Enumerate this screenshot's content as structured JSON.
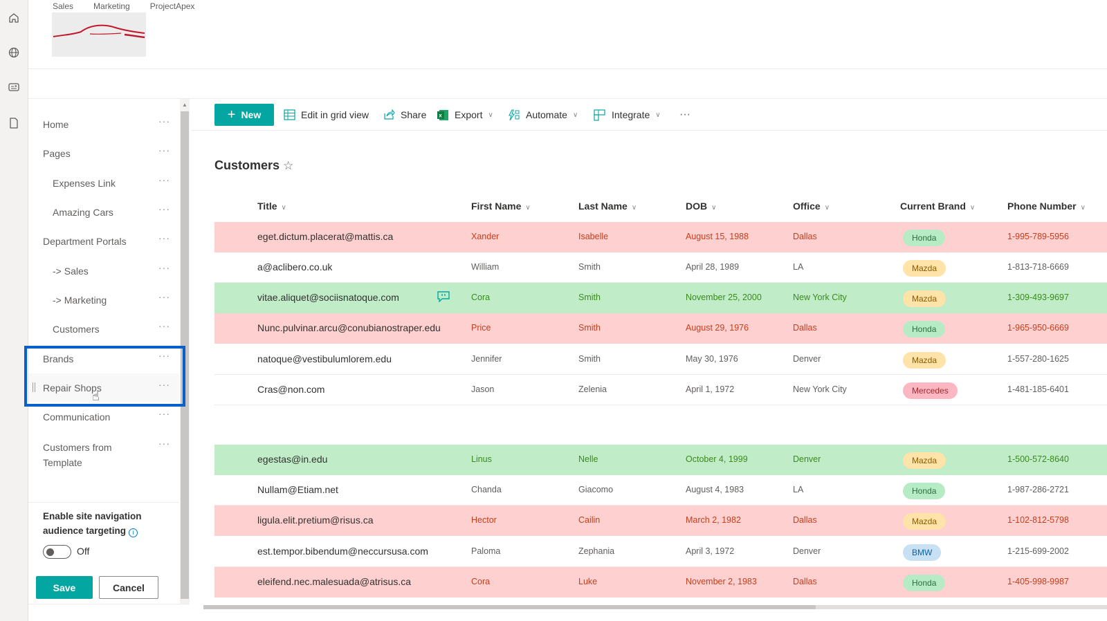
{
  "app_bar": {
    "icons": [
      "home-icon",
      "globe-icon",
      "news-icon",
      "document-icon"
    ]
  },
  "hub_nav": [
    "Sales",
    "Marketing",
    "ProjectApex"
  ],
  "command_bar": {
    "new_label": "New",
    "edit_grid_label": "Edit in grid view",
    "share_label": "Share",
    "export_label": "Export",
    "automate_label": "Automate",
    "integrate_label": "Integrate",
    "more_label": "···"
  },
  "nav": {
    "items": [
      {
        "label": "Home",
        "level": 0
      },
      {
        "label": "Pages",
        "level": 0
      },
      {
        "label": "Expenses Link",
        "level": 1
      },
      {
        "label": "Amazing Cars",
        "level": 1
      },
      {
        "label": "Department Portals",
        "level": 0
      },
      {
        "label": "-> Sales",
        "level": 1
      },
      {
        "label": "-> Marketing",
        "level": 1
      },
      {
        "label": "Customers",
        "level": 1
      },
      {
        "label": "Brands",
        "level": 0
      },
      {
        "label": "Repair Shops",
        "level": 0
      },
      {
        "label": "Communication",
        "level": 0
      },
      {
        "label": "Customers from",
        "label2": "Template",
        "level": 0
      }
    ],
    "more_label": "···",
    "audience_targeting_label_1": "Enable site navigation",
    "audience_targeting_label_2": "audience targeting",
    "info_label": "i",
    "toggle_state": "Off",
    "save_label": "Save",
    "cancel_label": "Cancel"
  },
  "list": {
    "title": "Customers",
    "columns": [
      "Title",
      "First Name",
      "Last Name",
      "DOB",
      "Office",
      "Current Brand",
      "Phone Number"
    ],
    "rows": [
      {
        "title": "eget.dictum.placerat@mattis.ca",
        "first": "Xander",
        "last": "Isabelle",
        "dob": "August 15, 1988",
        "office": "Dallas",
        "brand": "Honda",
        "phone": "1-995-789-5956",
        "style": "red"
      },
      {
        "title": "a@aclibero.co.uk",
        "first": "William",
        "last": "Smith",
        "dob": "April 28, 1989",
        "office": "LA",
        "brand": "Mazda",
        "phone": "1-813-718-6669",
        "style": "plain"
      },
      {
        "title": "vitae.aliquet@sociisnatoque.com",
        "first": "Cora",
        "last": "Smith",
        "dob": "November 25, 2000",
        "office": "New York City",
        "brand": "Mazda",
        "phone": "1-309-493-9697",
        "style": "green",
        "has_comment": true
      },
      {
        "title": "Nunc.pulvinar.arcu@conubianostraper.edu",
        "first": "Price",
        "last": "Smith",
        "dob": "August 29, 1976",
        "office": "Dallas",
        "brand": "Honda",
        "phone": "1-965-950-6669",
        "style": "red"
      },
      {
        "title": "natoque@vestibulumlorem.edu",
        "first": "Jennifer",
        "last": "Smith",
        "dob": "May 30, 1976",
        "office": "Denver",
        "brand": "Mazda",
        "phone": "1-557-280-1625",
        "style": "plain"
      },
      {
        "title": "Cras@non.com",
        "first": "Jason",
        "last": "Zelenia",
        "dob": "April 1, 1972",
        "office": "New York City",
        "brand": "Mercedes",
        "phone": "1-481-185-6401",
        "style": "plain"
      },
      {
        "title": "egestas@in.edu",
        "first": "Linus",
        "last": "Nelle",
        "dob": "October 4, 1999",
        "office": "Denver",
        "brand": "Mazda",
        "phone": "1-500-572-8640",
        "style": "green"
      },
      {
        "title": "Nullam@Etiam.net",
        "first": "Chanda",
        "last": "Giacomo",
        "dob": "August 4, 1983",
        "office": "LA",
        "brand": "Honda",
        "phone": "1-987-286-2721",
        "style": "plain"
      },
      {
        "title": "ligula.elit.pretium@risus.ca",
        "first": "Hector",
        "last": "Cailin",
        "dob": "March 2, 1982",
        "office": "Dallas",
        "brand": "Mazda",
        "phone": "1-102-812-5798",
        "style": "red"
      },
      {
        "title": "est.tempor.bibendum@neccursusa.com",
        "first": "Paloma",
        "last": "Zephania",
        "dob": "April 3, 1972",
        "office": "Denver",
        "brand": "BMW",
        "phone": "1-215-699-2002",
        "style": "plain"
      },
      {
        "title": "eleifend.nec.malesuada@atrisus.ca",
        "first": "Cora",
        "last": "Luke",
        "dob": "November 2, 1983",
        "office": "Dallas",
        "brand": "Honda",
        "phone": "1-405-998-9987",
        "style": "red"
      }
    ]
  },
  "colors": {
    "accent": "#03a6a1",
    "highlight_box": "#0a5fc8",
    "row_red": "#fed0d0",
    "row_green": "#c0ecc8"
  }
}
